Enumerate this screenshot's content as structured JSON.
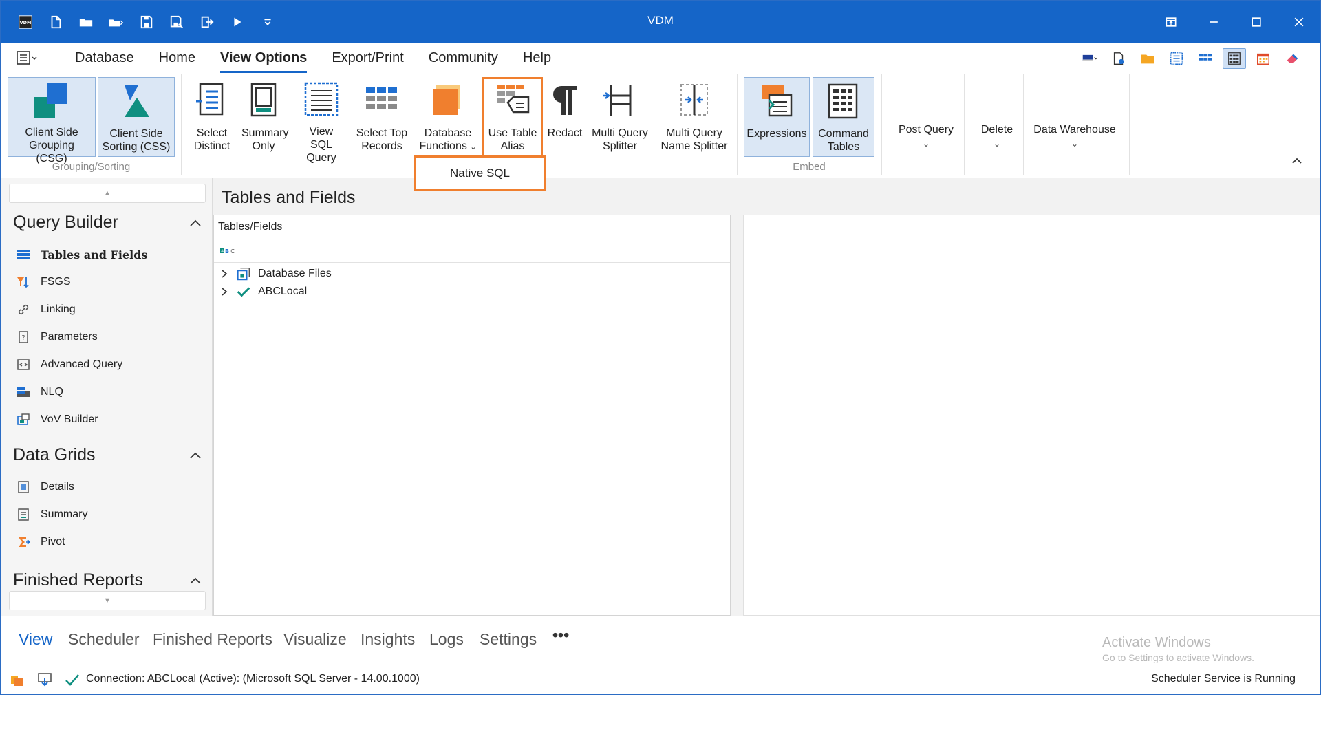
{
  "window": {
    "title": "VDM"
  },
  "ribbon_tabs": [
    "Database",
    "Home",
    "View Options",
    "Export/Print",
    "Community",
    "Help"
  ],
  "active_tab": "View Options",
  "ribbon": {
    "client_side_grouping": "Client Side Grouping (CSG)",
    "client_side_sorting": "Client Side Sorting (CSS)",
    "group_grouping_sorting": "Grouping/Sorting",
    "select_distinct": "Select Distinct",
    "summary_only": "Summary Only",
    "view_sql_query": "View SQL Query",
    "select_top_records": "Select Top Records",
    "database_functions": "Database Functions",
    "use_table_alias": "Use Table Alias",
    "redact": "Redact",
    "multi_query_splitter": "Multi Query Splitter",
    "multi_query_name_splitter": "Multi Query Name Splitter",
    "expressions": "Expressions",
    "command_tables": "Command Tables",
    "group_embed": "Embed",
    "post_query": "Post Query",
    "delete": "Delete",
    "data_warehouse": "Data Warehouse"
  },
  "popup": {
    "native_sql": "Native SQL"
  },
  "leftnav": {
    "query_builder": {
      "title": "Query Builder",
      "items": [
        "Tables and Fields",
        "FSGS",
        "Linking",
        "Parameters",
        "Advanced Query",
        "NLQ",
        "VoV Builder"
      ]
    },
    "data_grids": {
      "title": "Data Grids",
      "items": [
        "Details",
        "Summary",
        "Pivot"
      ]
    },
    "finished_reports": {
      "title": "Finished Reports"
    }
  },
  "main": {
    "title": "Tables and Fields",
    "tree_header": "Tables/Fields",
    "tree_nodes": [
      "Database Files",
      "ABCLocal"
    ]
  },
  "bottom_tabs": [
    "View",
    "Scheduler",
    "Finished Reports",
    "Visualize",
    "Insights",
    "Logs",
    "Settings",
    "•••"
  ],
  "activate_windows": {
    "line1": "Activate Windows",
    "line2": "Go to Settings to activate Windows."
  },
  "status": {
    "connection": "Connection: ABCLocal (Active): (Microsoft SQL Server - 14.00.1000)",
    "scheduler": "Scheduler Service is Running"
  },
  "colors": {
    "titlebar": "#1565c8",
    "accent_orange": "#f07f2e",
    "teal": "#0f8f80",
    "blue_icon": "#1f6fd1"
  }
}
